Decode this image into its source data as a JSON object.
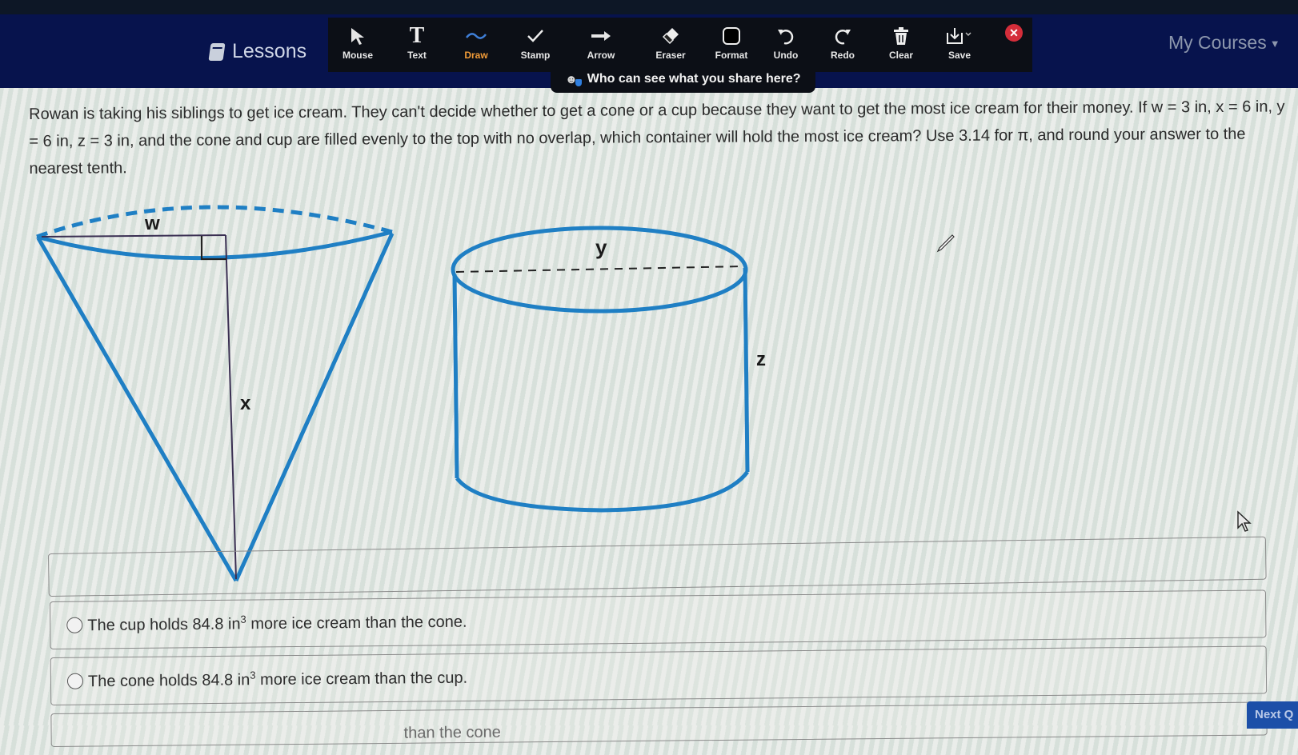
{
  "navbar": {
    "lessons_label": "Lessons",
    "my_courses_label": "My Courses",
    "bg_color": "#07134d"
  },
  "toolbar": {
    "tools": [
      {
        "label": "Mouse",
        "icon": "mouse-pointer-icon",
        "active": false
      },
      {
        "label": "Text",
        "icon": "text-icon",
        "active": false
      },
      {
        "label": "Draw",
        "icon": "draw-squiggle-icon",
        "active": true
      },
      {
        "label": "Stamp",
        "icon": "checkmark-stamp-icon",
        "active": false
      },
      {
        "label": "Arrow",
        "icon": "arrow-right-icon",
        "active": false
      },
      {
        "label": "Eraser",
        "icon": "eraser-icon",
        "active": false
      },
      {
        "label": "Format",
        "icon": "format-square-icon",
        "active": false
      },
      {
        "label": "Undo",
        "icon": "undo-icon",
        "active": false
      },
      {
        "label": "Redo",
        "icon": "redo-icon",
        "active": false
      },
      {
        "label": "Clear",
        "icon": "trash-icon",
        "active": false
      },
      {
        "label": "Save",
        "icon": "save-download-icon",
        "active": false
      }
    ],
    "active_color": "#f29c38",
    "close_icon": "close-icon",
    "share_banner": "Who can see what you share here?"
  },
  "question": {
    "text": "Rowan is taking his siblings to get ice cream. They can't decide whether to get a cone or a cup because they want to get the most ice cream for their money. If w = 3 in, x = 6 in, y = 6 in, z = 3 in, and the cone and cup are filled evenly to the top with no overlap, which container will hold the most ice cream? Use 3.14 for π, and round your answer to the nearest tenth."
  },
  "diagram": {
    "cone": {
      "radius_label": "w",
      "height_label": "x"
    },
    "cylinder": {
      "diameter_label": "y",
      "height_label": "z"
    },
    "stroke_color": "#1f7fc4"
  },
  "answers": [
    {
      "prefix": "The cup holds 84.8 in",
      "sup": "3",
      "suffix": " more ice cream than the cone."
    },
    {
      "prefix": "The cone holds 84.8 in",
      "sup": "3",
      "suffix": " more ice cream than the cup."
    },
    {
      "prefix": "",
      "sup": "",
      "suffix": "than the cone"
    }
  ],
  "next_button_label": "Next Q"
}
